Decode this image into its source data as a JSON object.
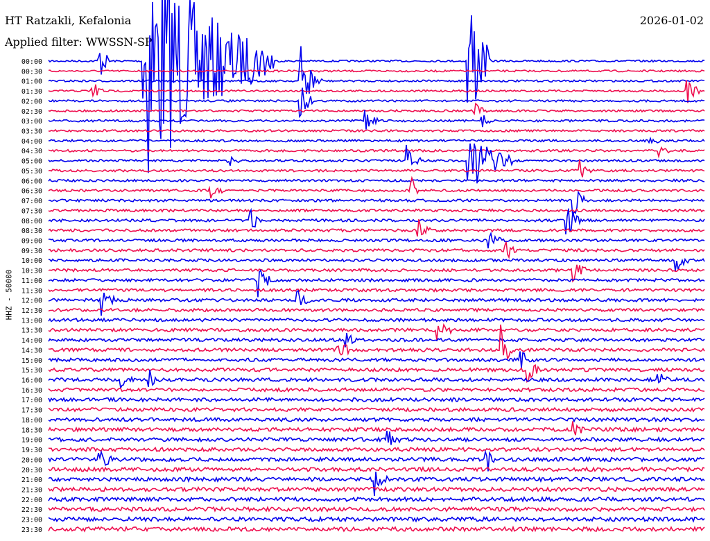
{
  "header": {
    "station": "HT Ratzakli, Kefalonia",
    "date": "2026-01-02",
    "filter": "Applied filter: WWSSN-SP"
  },
  "chart_data": {
    "type": "helicorder",
    "title": "HT Ratzakli, Kefalonia",
    "ylabel": "HHZ - 50000",
    "rows": [
      "00:00",
      "00:30",
      "01:00",
      "01:30",
      "02:00",
      "02:30",
      "03:00",
      "03:30",
      "04:00",
      "04:30",
      "05:00",
      "05:30",
      "06:00",
      "06:30",
      "07:00",
      "07:30",
      "08:00",
      "08:30",
      "09:00",
      "09:30",
      "10:00",
      "10:30",
      "11:00",
      "11:30",
      "12:00",
      "12:30",
      "13:00",
      "13:30",
      "14:00",
      "14:30",
      "15:00",
      "15:30",
      "16:00",
      "16:30",
      "17:00",
      "17:30",
      "18:00",
      "18:30",
      "19:00",
      "19:30",
      "20:00",
      "20:30",
      "21:00",
      "21:30",
      "22:00",
      "22:30",
      "23:00",
      "23:30"
    ],
    "row_minutes": 30,
    "trace_colors": [
      "#0000ee",
      "#ee0f4f"
    ],
    "events": [
      {
        "row": 0,
        "minute": 2.3,
        "amp": 2.2
      },
      {
        "row": 0,
        "minute": 4.3,
        "amp": 14,
        "dur": 6
      },
      {
        "row": 0,
        "minute": 19.2,
        "amp": 10,
        "dur": 1
      },
      {
        "row": 2,
        "minute": 11.5,
        "amp": 4,
        "dur": 1
      },
      {
        "row": 3,
        "minute": 2.0,
        "amp": 1.2
      },
      {
        "row": 3,
        "minute": 29.2,
        "amp": 1.6
      },
      {
        "row": 4,
        "minute": 11.5,
        "amp": 2.5
      },
      {
        "row": 5,
        "minute": 19.5,
        "amp": 0.8
      },
      {
        "row": 6,
        "minute": 14.5,
        "amp": 1.2
      },
      {
        "row": 6,
        "minute": 19.8,
        "amp": 0.7
      },
      {
        "row": 8,
        "minute": 27.5,
        "amp": 0.6
      },
      {
        "row": 9,
        "minute": 27.9,
        "amp": 0.6
      },
      {
        "row": 10,
        "minute": 8.2,
        "amp": 1.0
      },
      {
        "row": 10,
        "minute": 16.4,
        "amp": 1.6
      },
      {
        "row": 10,
        "minute": 19.2,
        "amp": 3.5,
        "dur": 2
      },
      {
        "row": 11,
        "minute": 24.3,
        "amp": 1.1
      },
      {
        "row": 13,
        "minute": 7.4,
        "amp": 0.8
      },
      {
        "row": 13,
        "minute": 16.5,
        "amp": 1.8
      },
      {
        "row": 14,
        "minute": 24.0,
        "amp": 1.8
      },
      {
        "row": 16,
        "minute": 9.2,
        "amp": 1.8
      },
      {
        "row": 16,
        "minute": 23.7,
        "amp": 2.5
      },
      {
        "row": 17,
        "minute": 16.9,
        "amp": 1.3
      },
      {
        "row": 18,
        "minute": 20.1,
        "amp": 1.6
      },
      {
        "row": 19,
        "minute": 20.8,
        "amp": 1.5
      },
      {
        "row": 20,
        "minute": 28.7,
        "amp": 1.2
      },
      {
        "row": 21,
        "minute": 24.0,
        "amp": 1.4
      },
      {
        "row": 22,
        "minute": 9.6,
        "amp": 1.8
      },
      {
        "row": 24,
        "minute": 2.4,
        "amp": 1.8
      },
      {
        "row": 24,
        "minute": 11.4,
        "amp": 1.0
      },
      {
        "row": 27,
        "minute": 17.8,
        "amp": 1.5
      },
      {
        "row": 28,
        "minute": 13.5,
        "amp": 1.0
      },
      {
        "row": 29,
        "minute": 13.2,
        "amp": 1.8
      },
      {
        "row": 29,
        "minute": 20.7,
        "amp": 2.2
      },
      {
        "row": 30,
        "minute": 21.6,
        "amp": 1.0
      },
      {
        "row": 31,
        "minute": 21.9,
        "amp": 1.3
      },
      {
        "row": 32,
        "minute": 3.3,
        "amp": 1.0
      },
      {
        "row": 32,
        "minute": 4.6,
        "amp": 1.2
      },
      {
        "row": 32,
        "minute": 27.8,
        "amp": 1.0
      },
      {
        "row": 37,
        "minute": 23.9,
        "amp": 1.0
      },
      {
        "row": 38,
        "minute": 15.5,
        "amp": 1.2
      },
      {
        "row": 40,
        "minute": 2.3,
        "amp": 1.5
      },
      {
        "row": 40,
        "minute": 20.0,
        "amp": 1.6
      },
      {
        "row": 42,
        "minute": 14.9,
        "amp": 1.8
      }
    ]
  }
}
